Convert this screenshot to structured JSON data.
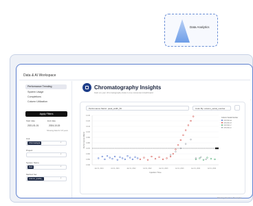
{
  "badge": {
    "label": "Data Analytics",
    "icon": "pyramid-icon"
  },
  "workspace": {
    "title": "Data & AI Workspace"
  },
  "sidebar": {
    "items": [
      {
        "label": "Performance Trending",
        "active": true
      },
      {
        "label": "System Usage",
        "active": false
      },
      {
        "label": "Completions",
        "active": false
      },
      {
        "label": "Column Utilization",
        "active": false
      }
    ],
    "apply_label": "Apply Filters",
    "start_date_label": "Start date",
    "end_date_label": "End date",
    "start_date": "2021-01-01",
    "end_date": "2024-10-15",
    "date_note": "Showing data for 3.8 years",
    "fields": [
      {
        "label": "Unit",
        "tag": "Chromatogra"
      },
      {
        "label": "Project",
        "tag": ""
      },
      {
        "label": "System Name",
        "tag": "Dart"
      },
      {
        "label": "Method Set",
        "tag": "column_quality_"
      }
    ]
  },
  "main": {
    "title": "Chromatography Insights",
    "subtitle": "Gain an your chromatography data in one convenient dashboard",
    "metric_select": "Performance Metric: peak_width_50",
    "color_select": "Color By: column_serial_number",
    "footnote": "Showing data from 46 samples"
  },
  "chart_data": {
    "type": "scatter",
    "xlabel": "Injection Time",
    "ylabel": "Performance Metric",
    "x_ticks": [
      "Jan 01, 2021",
      "Jul 01, 2021",
      "Jan 01, 2022",
      "Jul 01, 2022",
      "Jan 01, 2023",
      "Jul 01, 2023",
      "Jan 01, 2024",
      "Jul 01, 2024"
    ],
    "y_ticks": [
      "0.130",
      "0.120",
      "0.110",
      "0.100",
      "0.090",
      "0.080",
      "0.070",
      "0.060",
      "0.050",
      "0.040"
    ],
    "legend_title": "Column Serial Number",
    "legend_entries": [
      {
        "name": "CM12345-A",
        "color": "#2a56c6"
      },
      {
        "name": "CM12345-B",
        "color": "#d0342c"
      },
      {
        "name": "CM12345-C",
        "color": "#2e9e5b"
      },
      {
        "name": "CM12345-D",
        "color": "#8a8f99"
      }
    ],
    "threshold": 0.07,
    "series": [
      {
        "name": "CM12345-A",
        "color": "#2a56c6",
        "points": [
          [
            0.05,
            0.052
          ],
          [
            0.08,
            0.055
          ],
          [
            0.1,
            0.05
          ],
          [
            0.12,
            0.056
          ],
          [
            0.14,
            0.053
          ],
          [
            0.16,
            0.051
          ],
          [
            0.18,
            0.055
          ],
          [
            0.2,
            0.049
          ],
          [
            0.22,
            0.054
          ],
          [
            0.24,
            0.052
          ],
          [
            0.26,
            0.05
          ],
          [
            0.28,
            0.056
          ],
          [
            0.3,
            0.053
          ],
          [
            0.32,
            0.05
          ],
          [
            0.34,
            0.054
          ],
          [
            0.36,
            0.052
          ]
        ]
      },
      {
        "name": "CM12345-B",
        "color": "#d0342c",
        "points": [
          [
            0.38,
            0.05
          ],
          [
            0.41,
            0.053
          ],
          [
            0.44,
            0.049
          ],
          [
            0.47,
            0.055
          ],
          [
            0.5,
            0.051
          ],
          [
            0.53,
            0.054
          ],
          [
            0.56,
            0.05
          ],
          [
            0.59,
            0.052
          ],
          [
            0.62,
            0.055
          ],
          [
            0.64,
            0.06
          ],
          [
            0.66,
            0.068
          ],
          [
            0.68,
            0.076
          ],
          [
            0.7,
            0.085
          ],
          [
            0.72,
            0.094
          ],
          [
            0.74,
            0.103
          ],
          [
            0.76,
            0.112
          ],
          [
            0.78,
            0.12
          ],
          [
            0.8,
            0.128
          ]
        ]
      },
      {
        "name": "CM12345-C",
        "color": "#2e9e5b",
        "points": [
          [
            0.82,
            0.05
          ],
          [
            0.85,
            0.052
          ],
          [
            0.88,
            0.049
          ],
          [
            0.91,
            0.053
          ],
          [
            0.94,
            0.051
          ],
          [
            0.97,
            0.05
          ]
        ]
      },
      {
        "name": "CM12345-D",
        "color": "#8a8f99",
        "points": [
          [
            0.62,
            0.058
          ],
          [
            0.66,
            0.064
          ],
          [
            0.7,
            0.07
          ],
          [
            0.74,
            0.078
          ],
          [
            0.78,
            0.086
          ],
          [
            0.82,
            0.052
          ],
          [
            0.86,
            0.054
          ],
          [
            0.9,
            0.05
          ]
        ]
      }
    ]
  }
}
